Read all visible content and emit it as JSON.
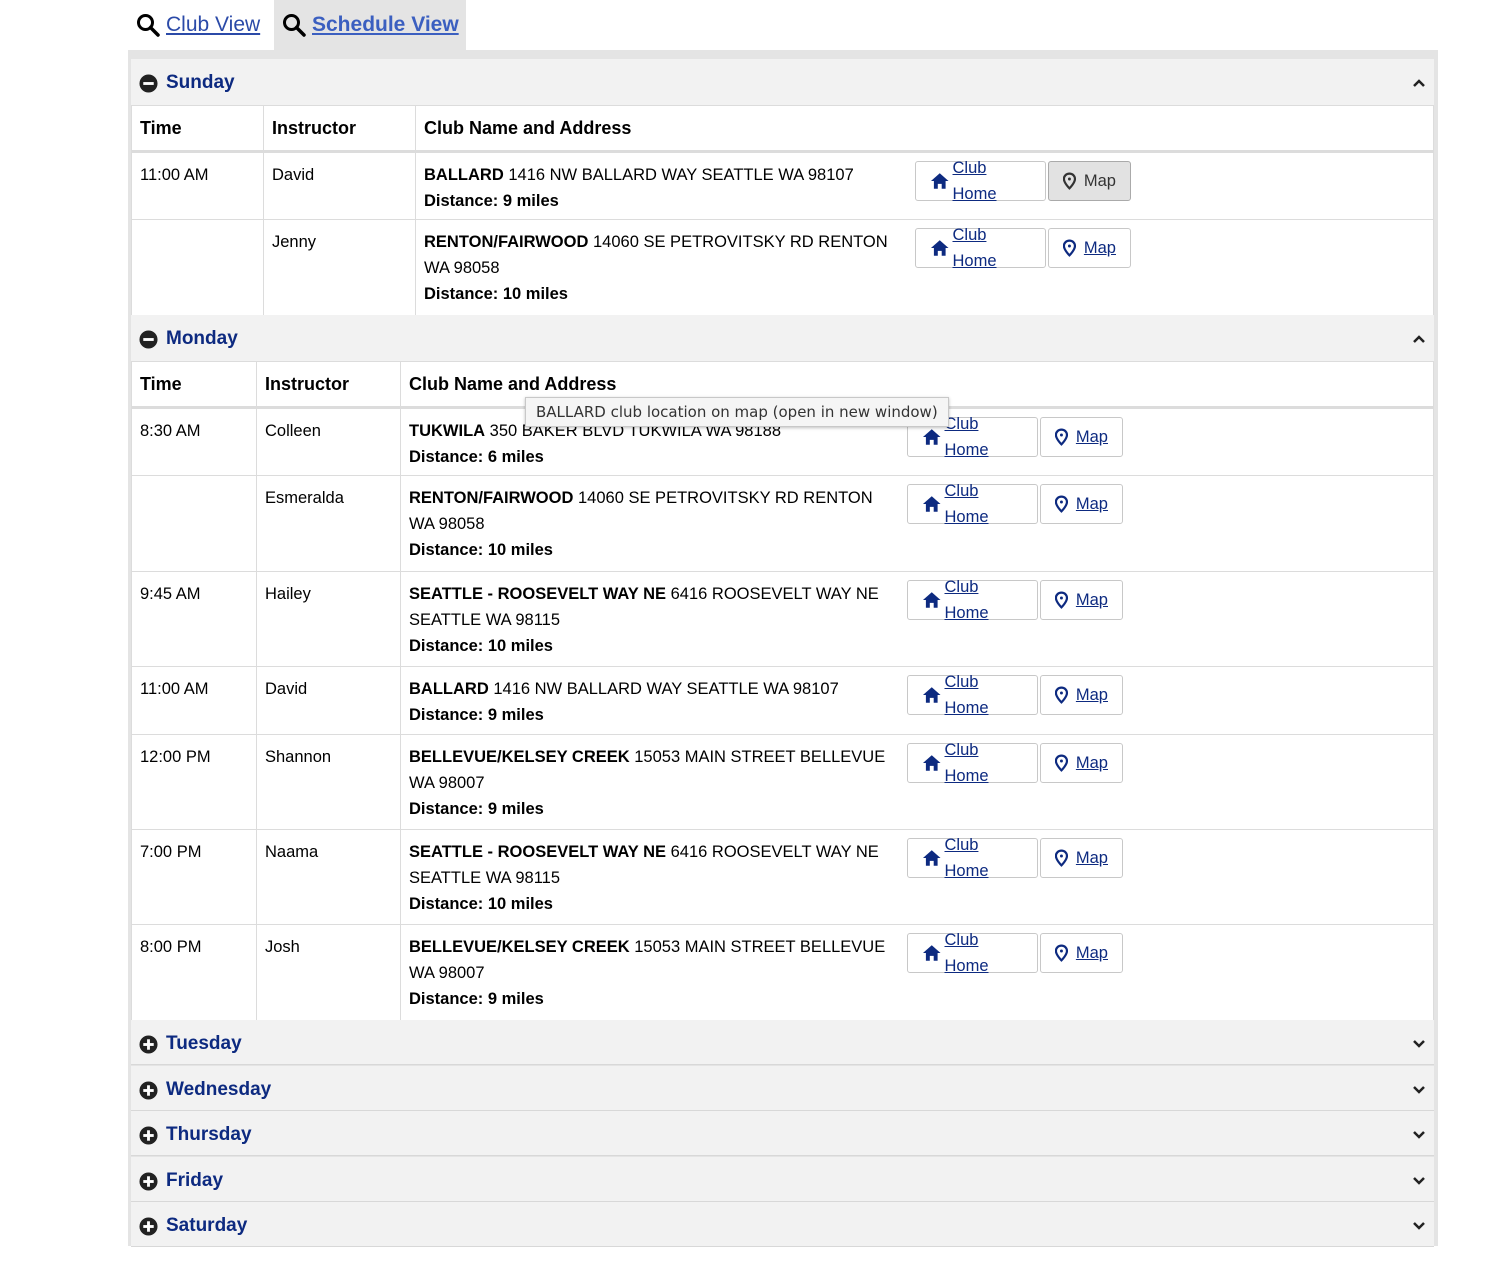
{
  "tabs": {
    "club_view": "Club View",
    "schedule_view": "Schedule View"
  },
  "columns": {
    "time": "Time",
    "instructor": "Instructor",
    "club": "Club Name and Address"
  },
  "buttons": {
    "club_home": "Club Home",
    "map": "Map"
  },
  "tooltip": "BALLARD club location on map (open in new window)",
  "days": [
    {
      "name": "Sunday",
      "expanded": true,
      "rows": [
        {
          "time": "11:00 AM",
          "instructor": "David",
          "club": "BALLARD",
          "address": "1416 NW BALLARD WAY SEATTLE WA 98107",
          "distance": "Distance: 9 miles"
        },
        {
          "time": "",
          "instructor": "Jenny",
          "club": "RENTON/FAIRWOOD",
          "address": "14060 SE PETROVITSKY RD RENTON WA 98058",
          "distance": "Distance: 10 miles"
        }
      ]
    },
    {
      "name": "Monday",
      "expanded": true,
      "rows": [
        {
          "time": "8:30 AM",
          "instructor": "Colleen",
          "club": "TUKWILA",
          "address": "350 BAKER BLVD TUKWILA WA 98188",
          "distance": "Distance: 6 miles"
        },
        {
          "time": "",
          "instructor": "Esmeralda",
          "club": "RENTON/FAIRWOOD",
          "address": "14060 SE PETROVITSKY RD RENTON WA 98058",
          "distance": "Distance: 10 miles"
        },
        {
          "time": "9:45 AM",
          "instructor": "Hailey",
          "club": "SEATTLE - ROOSEVELT WAY NE",
          "address": "6416 ROOSEVELT WAY NE SEATTLE WA 98115",
          "distance": "Distance: 10 miles"
        },
        {
          "time": "11:00 AM",
          "instructor": "David",
          "club": "BALLARD",
          "address": "1416 NW BALLARD WAY SEATTLE WA 98107",
          "distance": "Distance: 9 miles"
        },
        {
          "time": "12:00 PM",
          "instructor": "Shannon",
          "club": "BELLEVUE/KELSEY CREEK",
          "address": "15053 MAIN STREET BELLEVUE WA 98007",
          "distance": "Distance: 9 miles"
        },
        {
          "time": "7:00 PM",
          "instructor": "Naama",
          "club": "SEATTLE - ROOSEVELT WAY NE",
          "address": "6416 ROOSEVELT WAY NE SEATTLE WA 98115",
          "distance": "Distance: 10 miles"
        },
        {
          "time": "8:00 PM",
          "instructor": "Josh",
          "club": "BELLEVUE/KELSEY CREEK",
          "address": "15053 MAIN STREET BELLEVUE WA 98007",
          "distance": "Distance: 9 miles"
        }
      ]
    },
    {
      "name": "Tuesday",
      "expanded": false,
      "rows": []
    },
    {
      "name": "Wednesday",
      "expanded": false,
      "rows": []
    },
    {
      "name": "Thursday",
      "expanded": false,
      "rows": []
    },
    {
      "name": "Friday",
      "expanded": false,
      "rows": []
    },
    {
      "name": "Saturday",
      "expanded": false,
      "rows": []
    }
  ],
  "colors": {
    "link": "#0d2a80",
    "tab_link": "#2b4aa8",
    "panel_bg": "#e4e4e4",
    "header_bg": "#f2f2f2"
  }
}
